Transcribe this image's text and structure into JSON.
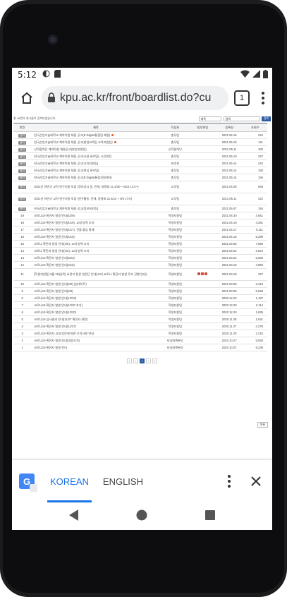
{
  "status_bar": {
    "time": "5:12"
  },
  "browser": {
    "url": "kpu.ac.kr/front/boardlist.do?cu",
    "tab_count": "1"
  },
  "board": {
    "total_text": "총 18번의 게시물이 검색되었습니다.",
    "search_select": "제목",
    "search_placeholder": "검색",
    "search_button": "검색",
    "headers": [
      "번호",
      "제목",
      "작성자",
      "첨부파일",
      "등록일",
      "조회수"
    ],
    "rows": [
      {
        "no": "공지",
        "title": "한국산업기술대학교 계약직원 채용 공고(E-Digital통합팀 채용)",
        "new": true,
        "author": "총무팀",
        "date": "2021.05.15",
        "views": "224"
      },
      {
        "no": "공지",
        "title": "한국산업기술대학교 계약직원 채용 공고(창업교육팀 교육지원팀)",
        "new": true,
        "author": "총무팀",
        "date": "2021.05.15",
        "views": "141"
      },
      {
        "no": "공지",
        "title": "산학협력단 계약직원 채용공고(창업지원팀)",
        "new": false,
        "author": "산학협력단",
        "date": "2021.05.11",
        "views": "183"
      },
      {
        "no": "공지",
        "title": "한국산업기술대학교 계약직원 채용 공고(시설 관리팀), 시간연장",
        "new": false,
        "author": "총무팀",
        "date": "2021.05.10",
        "views": "247"
      },
      {
        "no": "공지",
        "title": "한국산업기술대학교 계약직원 채용 공고(교육지원팀)",
        "new": false,
        "author": "회추연",
        "date": "2021.05.14",
        "views": "242"
      },
      {
        "no": "공지",
        "title": "한국산업기술대학교 계약직원 채용 공고(취업 관리팀)",
        "new": false,
        "author": "총무팀",
        "date": "2021.05.14",
        "views": "193"
      },
      {
        "no": "공지",
        "title": "한국산업기술대학교 계약직원 채용 공고(E-Digital통합지원센터)",
        "new": false,
        "author": "총무팀",
        "date": "2021.05.14",
        "views": "194"
      },
      {
        "no": "공지",
        "title": "2021년 하반기 교직 연구지원 모집 (정보공시 등, 전체, 설명회 21.4/30 ~ 5/14 11시~)",
        "new": false,
        "author": "교무팀",
        "date": "2021.04.28",
        "views": "936",
        "tall": true
      },
      {
        "no": "공지",
        "title": "2021년 하반기 교직 연구지원 모집 (연구활동, 전체, 설명회 21.5/12 ~ 9/3 17시)",
        "new": false,
        "author": "교무팀",
        "date": "2021.05.11",
        "views": "422",
        "tall": true
      },
      {
        "no": "공지",
        "title": "한국산업기술대학교 계약직원 채용 공고(정보보안팀)",
        "new": false,
        "author": "총무팀",
        "date": "2021.05.07",
        "views": "194"
      },
      {
        "no": "19",
        "title": "코로나19 확진자 발생 안내(4/29)",
        "new": false,
        "author": "학생지원팀",
        "date": "2021.04.30",
        "views": "4,641"
      },
      {
        "no": "18",
        "title": "코로나19 확진자 발생 안내(4/19), 교내 방역 조치",
        "new": false,
        "author": "학생지원팀",
        "date": "2021.04.19",
        "views": "4,281"
      },
      {
        "no": "17",
        "title": "코로나19 확진자 발생 안내(4/17), 건물 출입 통제",
        "new": false,
        "author": "학생지원팀",
        "date": "2021.04.17",
        "views": "6,111"
      },
      {
        "no": "16",
        "title": "코로나19 확진자 발생 안내(4/16)",
        "new": false,
        "author": "학생지원팀",
        "date": "2021.04.16",
        "views": "5,299"
      },
      {
        "no": "15",
        "title": "코로나 확진자 발생 안내(4/6), 교내 방역 조치",
        "new": false,
        "author": "학생지원팀",
        "date": "2021.04.06",
        "views": "7,895"
      },
      {
        "no": "14",
        "title": "코로나 확진자 발생 안내(4/2), 교내 방역 조치",
        "new": false,
        "author": "학생지원팀",
        "date": "2021.04.02",
        "views": "3,624"
      },
      {
        "no": "13",
        "title": "코로나19 확진자 발생 안내(3/22)",
        "new": false,
        "author": "학생지원팀",
        "date": "2021.03.22",
        "views": "5,930"
      },
      {
        "no": "12",
        "title": "코로나19 확진자 발생 안내(3/16)",
        "new": false,
        "author": "학생지원팀",
        "date": "2021.03.16",
        "views": "4,869"
      },
      {
        "no": "11",
        "title": "[학생지원팀] 3월 18일(목) 서정리 현장 방문단 안내(교내 코로나 확진자 발생 후속 진행 안내)",
        "new": false,
        "author": "학생지원팀",
        "files": true,
        "date": "2021.03.18",
        "views": "347",
        "tall": true
      },
      {
        "no": "10",
        "title": "코로나19 확진자 발생 안내(3/9) (업데이트)",
        "new": false,
        "author": "학생지원팀",
        "date": "2021.03.09",
        "views": "3,410"
      },
      {
        "no": "9",
        "title": "코로나19 확진자 발생 안내(3/9)",
        "new": false,
        "author": "학생지원팀",
        "date": "2021.03.09",
        "views": "6,848"
      },
      {
        "no": "8",
        "title": "코로나19 확진자 발생 안내(12/23)",
        "new": false,
        "author": "학생지원팀",
        "date": "2020.12.23",
        "views": "1,187"
      },
      {
        "no": "7",
        "title": "코로나19 확진자 발생 안내(12/20 추가)",
        "new": false,
        "author": "학생지원팀",
        "date": "2020.12.20",
        "views": "2,114"
      },
      {
        "no": "6",
        "title": "코로나19 확진자 발생 안내(12/20)",
        "new": false,
        "author": "학생지원팀",
        "date": "2020.12.20",
        "views": "1,835"
      },
      {
        "no": "5",
        "title": "코로나19 심사결과 안내(11/27 확진자 관련)",
        "new": false,
        "author": "학생지원팀",
        "date": "2020.11.28",
        "views": "1,631"
      },
      {
        "no": "4",
        "title": "코로나19 확진자 발생 안내(11/27)",
        "new": false,
        "author": "학생지원팀",
        "date": "2020.11.27",
        "views": "4,279"
      },
      {
        "no": "3",
        "title": "코로나19 확진자 교내 방문에 따른 조치사항 안내",
        "new": false,
        "author": "학생지원팀",
        "date": "2020.11.20",
        "views": "2,215"
      },
      {
        "no": "2",
        "title": "코로나19 확진자 발생 안내(대응조치)",
        "new": false,
        "author": "비상대책본부",
        "date": "2020.10.27",
        "views": "5,930"
      },
      {
        "no": "1",
        "title": "코로나19 확진자 발생 안내",
        "new": false,
        "author": "비상대책본부",
        "date": "2020.10.27",
        "views": "9,239"
      }
    ],
    "pager": [
      "«",
      "‹",
      "1",
      "›",
      "»"
    ],
    "pager_active": "1",
    "write_button": "목록"
  },
  "translate_bar": {
    "lang_active": "KOREAN",
    "lang_other": "ENGLISH"
  },
  "colors": {
    "accent": "#1a73e8",
    "search_btn": "#2c5aa0"
  },
  "icons": [
    "home-icon",
    "lock-icon",
    "tabs-icon",
    "more-vert-icon",
    "google-translate-icon",
    "close-icon",
    "back-icon",
    "home-nav-icon",
    "recents-icon"
  ]
}
